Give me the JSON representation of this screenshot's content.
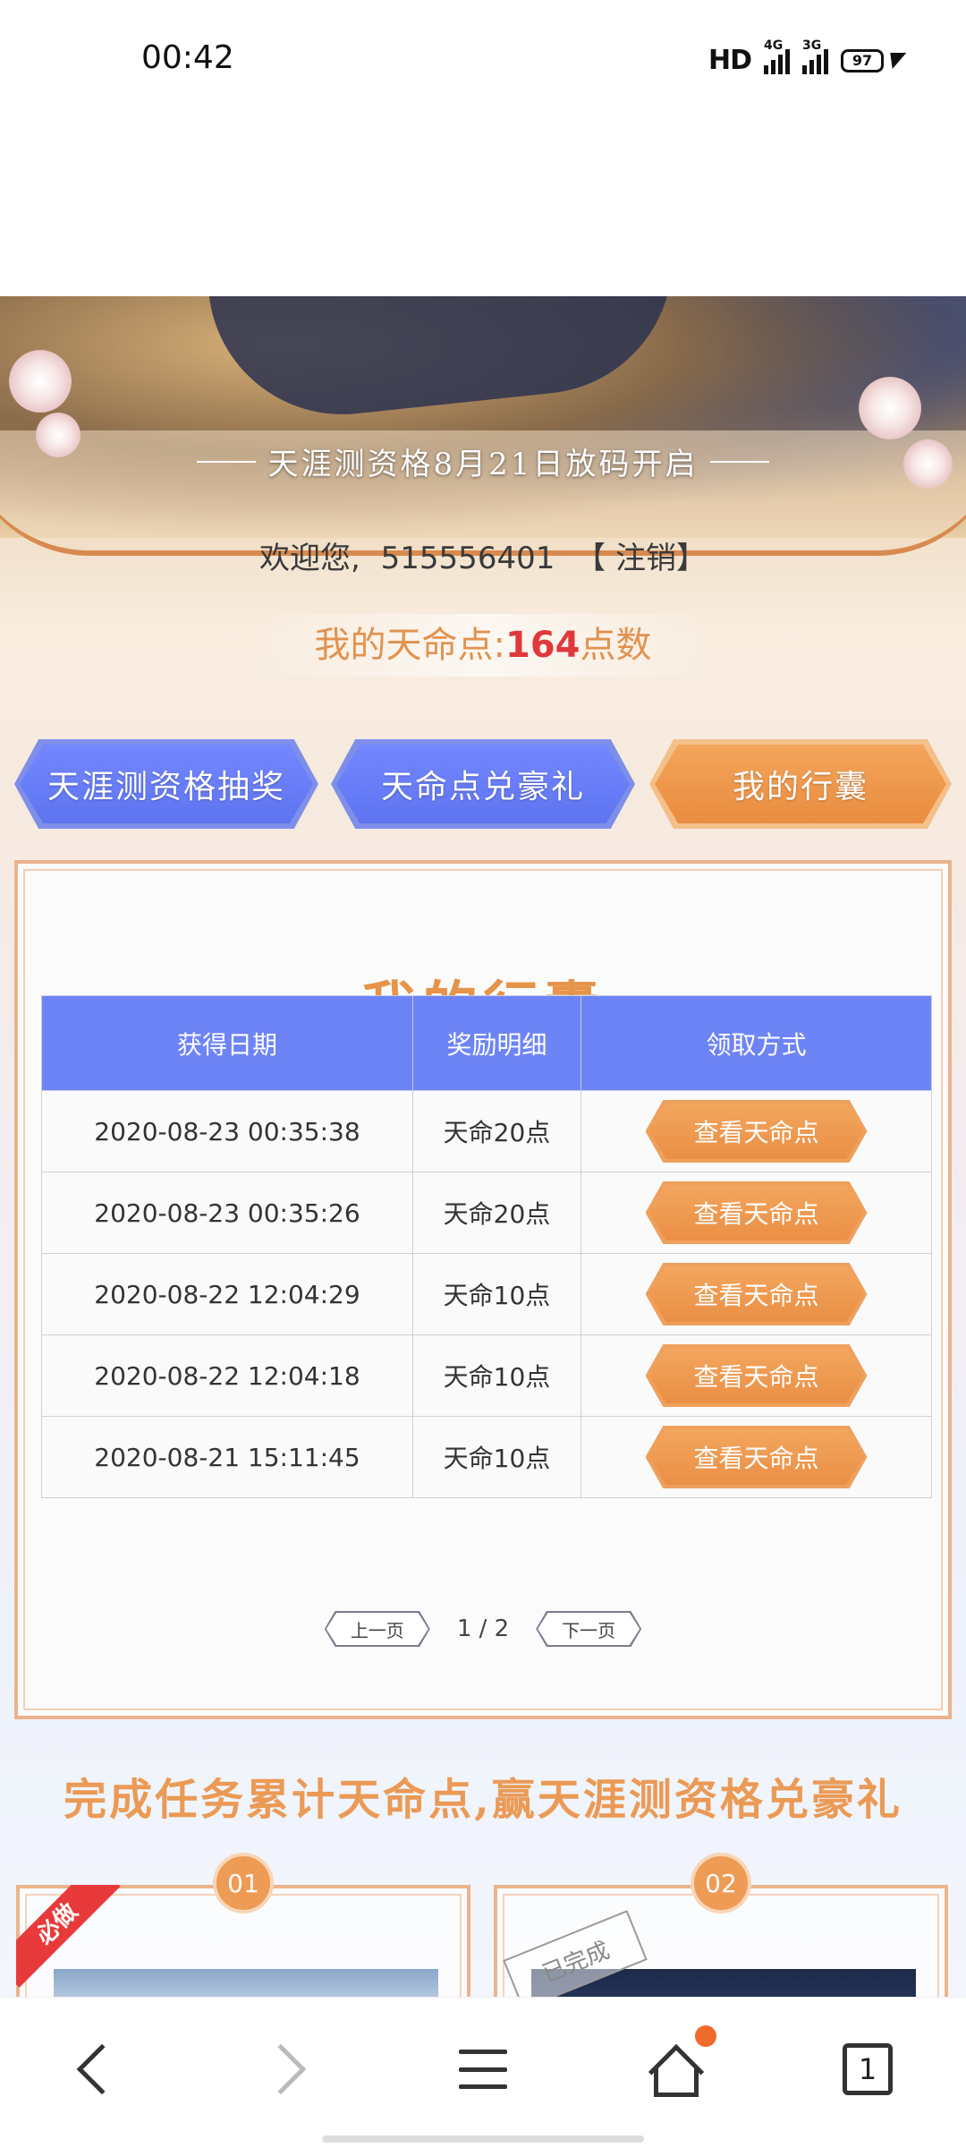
{
  "status_bar": {
    "time": "00:42",
    "network_label": "HD",
    "signal1_type": "4G",
    "signal2_type": "3G",
    "battery": "97"
  },
  "hero": {
    "announcement": "天涯测资格8月21日放码开启"
  },
  "welcome": {
    "greeting": "欢迎您,",
    "user_id": "515556401",
    "logout_label": "【 注销】"
  },
  "points": {
    "label": "我的天命点:",
    "value": "164",
    "unit": "点数"
  },
  "tabs": [
    {
      "label": "天涯测资格抽奖"
    },
    {
      "label": "天命点兑豪礼"
    },
    {
      "label": "我的行囊"
    }
  ],
  "panel": {
    "title": "我的行囊",
    "columns": [
      "获得日期",
      "奖励明细",
      "领取方式"
    ],
    "rows": [
      {
        "date": "2020-08-23 00:35:38",
        "reward": "天命20点",
        "action": "查看天命点"
      },
      {
        "date": "2020-08-23 00:35:26",
        "reward": "天命20点",
        "action": "查看天命点"
      },
      {
        "date": "2020-08-22 12:04:29",
        "reward": "天命10点",
        "action": "查看天命点"
      },
      {
        "date": "2020-08-22 12:04:18",
        "reward": "天命10点",
        "action": "查看天命点"
      },
      {
        "date": "2020-08-21 15:11:45",
        "reward": "天命10点",
        "action": "查看天命点"
      }
    ],
    "pager": {
      "prev_label": "上一页",
      "indicator": "1 / 2",
      "next_label": "下一页"
    }
  },
  "tasks": {
    "heading": "完成任务累计天命点,赢天涯测资格兑豪礼",
    "cards": [
      {
        "number": "01",
        "badge": "必做"
      },
      {
        "number": "02",
        "stamp": "已完成"
      }
    ]
  },
  "bottom_nav": {
    "tab_count": "1"
  },
  "colors": {
    "accent_orange": "#e98c3f",
    "tab_blue": "#6d84f6",
    "points_red": "#e0383c",
    "notification_dot": "#f06a2b"
  }
}
